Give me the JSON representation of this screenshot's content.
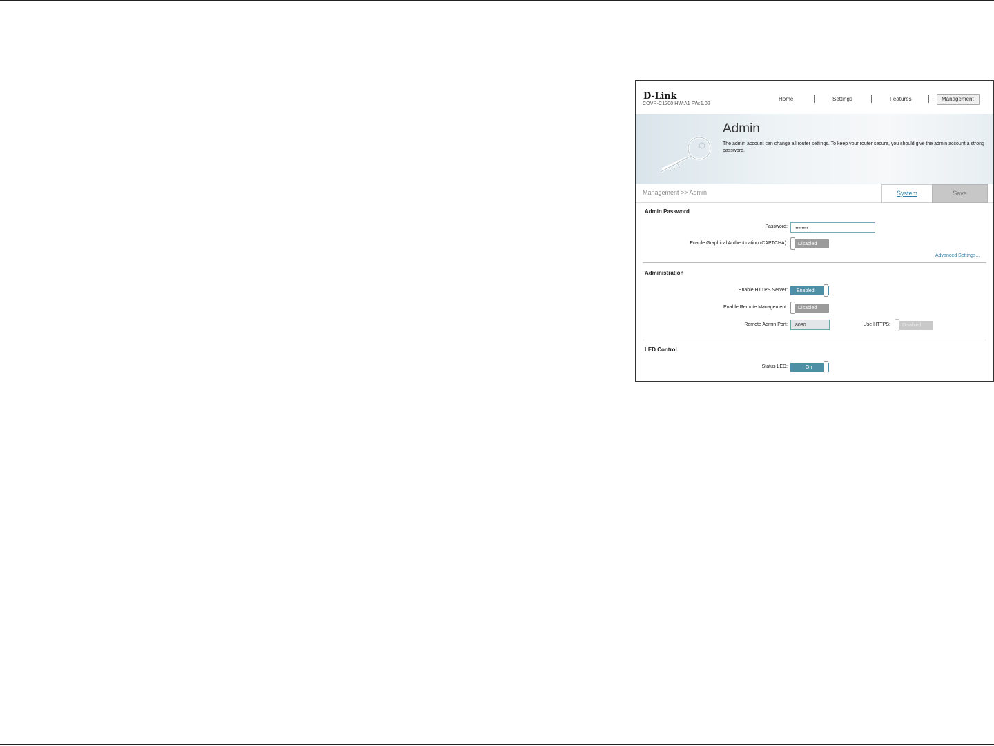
{
  "brand": {
    "logo": "D-Link",
    "model": "COVR-C1200 HW:A1 FW:1.02"
  },
  "nav": {
    "items": [
      "Home",
      "Settings",
      "Features",
      "Management"
    ],
    "active": "Management"
  },
  "banner": {
    "title": "Admin",
    "description": "The admin account can change all router settings. To keep your router secure, you should give the admin account a strong password.",
    "icon": "key-icon"
  },
  "breadcrumb": "Management >> Admin",
  "buttons": {
    "system": "System",
    "save": "Save"
  },
  "admin_password": {
    "heading": "Admin Password",
    "password_label": "Password:",
    "password_value": "••••••••",
    "captcha_label": "Enable Graphical Authentication (CAPTCHA):",
    "captcha_state": "Disabled",
    "advanced_link": "Advanced Settings..."
  },
  "administration": {
    "heading": "Administration",
    "https_label": "Enable HTTPS Server:",
    "https_state": "Enabled",
    "remote_label": "Enable Remote Management:",
    "remote_state": "Disabled",
    "port_label": "Remote Admin Port:",
    "port_value": "8080",
    "use_https_label": "Use HTTPS:",
    "use_https_state": "Disabled"
  },
  "led_control": {
    "heading": "LED Control",
    "status_label": "Status LED:",
    "status_state": "On"
  },
  "colors": {
    "accent": "#4f8fa6",
    "toggle_off": "#9b9b9b",
    "link": "#2e7ea8"
  }
}
